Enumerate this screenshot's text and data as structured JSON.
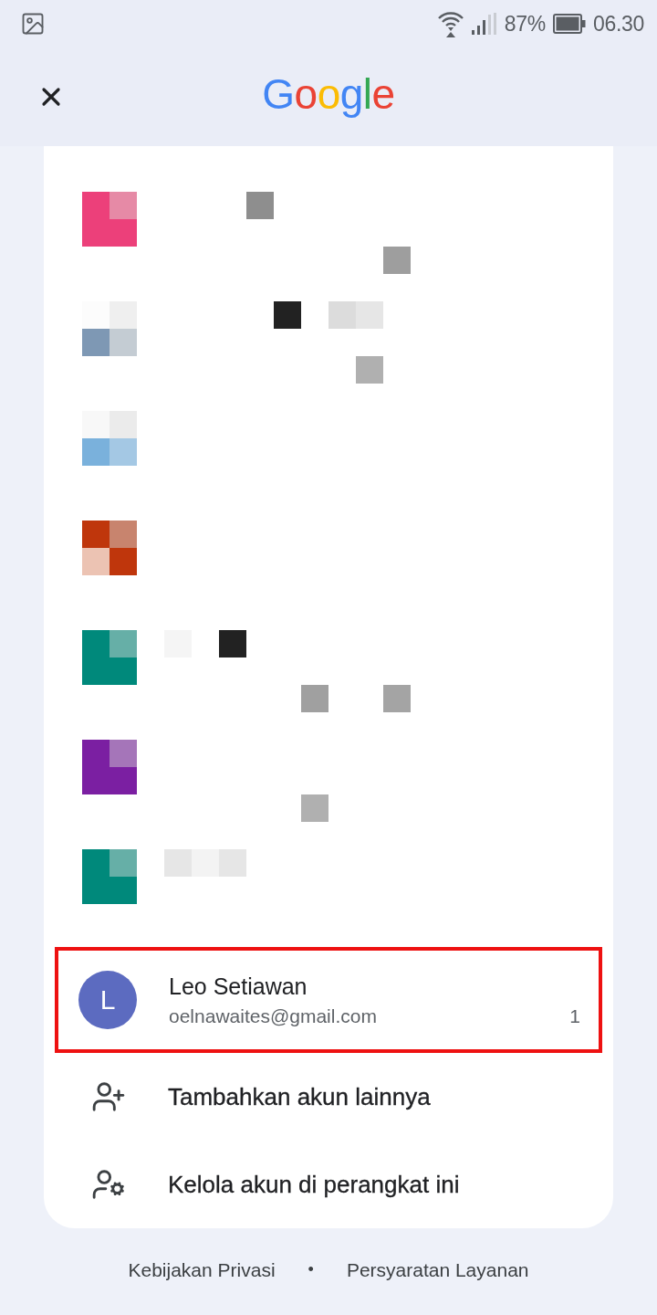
{
  "status_bar": {
    "battery": "87%",
    "time": "06.30"
  },
  "header": {
    "logo": "Google"
  },
  "accounts": [
    {
      "kind": "redacted",
      "avatar": [
        {
          "color": "#ec407a"
        },
        {
          "color": "#e68aa6"
        },
        {
          "color": "#ec407a"
        },
        {
          "color": "#ec407a"
        }
      ],
      "name_cells": [
        null,
        null,
        null,
        {
          "color": "#8e8e8e"
        }
      ],
      "email_cells": [
        null,
        null,
        null,
        null,
        null,
        null,
        null,
        null,
        {
          "color": "#9e9e9e"
        }
      ]
    },
    {
      "kind": "redacted",
      "avatar": [
        {
          "color": "#fcfcfc"
        },
        {
          "color": "#efefef"
        },
        {
          "color": "#7e98b4"
        },
        {
          "color": "#c4ccd3"
        }
      ],
      "name_cells": [
        null,
        null,
        null,
        null,
        {
          "color": "#222222"
        },
        null,
        {
          "color": "#dcdcdc"
        },
        {
          "color": "#e6e6e6"
        }
      ],
      "email_cells": [
        null,
        null,
        null,
        null,
        null,
        null,
        null,
        {
          "color": "#b0b0b0"
        }
      ]
    },
    {
      "kind": "redacted",
      "avatar": [
        {
          "color": "#f8f8f8"
        },
        {
          "color": "#ebebeb"
        },
        {
          "color": "#7ab1dc"
        },
        {
          "color": "#a4c8e4"
        }
      ]
    },
    {
      "kind": "redacted",
      "avatar": [
        {
          "color": "#bf360c"
        },
        {
          "color": "#c8846e"
        },
        {
          "color": "#ecc3b3"
        },
        {
          "color": "#bf360c"
        }
      ]
    },
    {
      "kind": "redacted",
      "avatar": [
        {
          "color": "#00897b"
        },
        {
          "color": "#66afa7"
        },
        {
          "color": "#00897b"
        },
        {
          "color": "#00897b"
        }
      ],
      "name_cells": [
        {
          "color": "#f5f5f5"
        },
        null,
        {
          "color": "#222222"
        }
      ],
      "email_cells": [
        null,
        null,
        null,
        null,
        null,
        {
          "color": "#a0a0a0"
        },
        null,
        null,
        {
          "color": "#a4a4a4"
        }
      ]
    },
    {
      "kind": "redacted",
      "avatar": [
        {
          "color": "#7b1fa2"
        },
        {
          "color": "#a575b9"
        },
        {
          "color": "#7b1fa2"
        },
        {
          "color": "#7b1fa2"
        }
      ],
      "email_cells": [
        null,
        null,
        null,
        null,
        null,
        {
          "color": "#b0b0b0"
        }
      ]
    },
    {
      "kind": "redacted",
      "avatar": [
        {
          "color": "#00897b"
        },
        {
          "color": "#66afa7"
        },
        {
          "color": "#00897b"
        },
        {
          "color": "#00897b"
        }
      ],
      "name_cells": [
        {
          "color": "#e6e6e6"
        },
        {
          "color": "#f3f3f3"
        },
        {
          "color": "#e6e6e6"
        }
      ]
    },
    {
      "kind": "account",
      "initial": "L",
      "color": "#5c6bc0",
      "name": "Leo Setiawan",
      "email": "oelnawaites@gmail.com",
      "count": "1",
      "highlighted": true
    }
  ],
  "actions": [
    {
      "kind": "add",
      "label": "Tambahkan akun lainnya"
    },
    {
      "kind": "manage",
      "label": "Kelola akun di perangkat ini"
    }
  ],
  "footer": {
    "links": [
      "Kebijakan Privasi",
      "Persyaratan Layanan"
    ],
    "separator": "•"
  }
}
